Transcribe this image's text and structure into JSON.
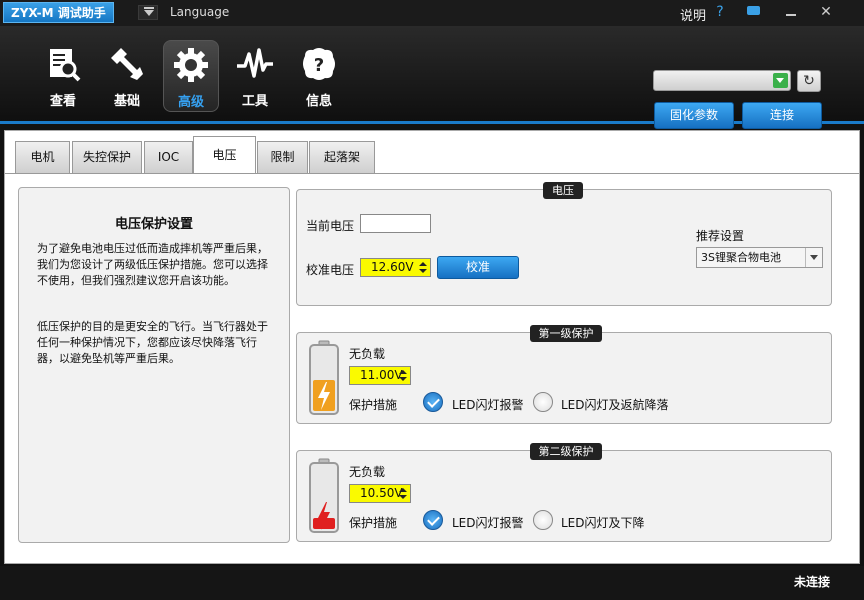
{
  "titlebar": {
    "app_title": "ZYX-M 调试助手",
    "language": "Language",
    "help": "说明",
    "help_icon": "?"
  },
  "toolbar": {
    "nav": [
      {
        "label": "查看",
        "icon": "view-icon"
      },
      {
        "label": "基础",
        "icon": "wrench-icon"
      },
      {
        "label": "高级",
        "icon": "gear-icon"
      },
      {
        "label": "工具",
        "icon": "pulse-icon"
      },
      {
        "label": "信息",
        "icon": "info-icon"
      }
    ],
    "active_nav": "高级",
    "firmware_button": "固化参数",
    "connect_button": "连接",
    "port_value": ""
  },
  "tabs": [
    "电机",
    "失控保护",
    "IOC",
    "电压",
    "限制",
    "起落架"
  ],
  "active_tab": "电压",
  "info": {
    "title": "电压保护设置",
    "para1": "为了避免电池电压过低而造成摔机等严重后果，我们为您设计了两级低压保护措施。您可以选择不使用，但我们强烈建议您开启该功能。",
    "para2": "低压保护的目的是更安全的飞行。当飞行器处于任何一种保护情况下，您都应该尽快降落飞行器，以避免坠机等严重后果。"
  },
  "voltage": {
    "group_title": "电压",
    "current_label": "当前电压",
    "current_value": "",
    "calibrate_label": "校准电压",
    "calibrate_value": "12.60V",
    "calibrate_button": "校准",
    "recommend_label": "推荐设置",
    "recommend_value": "3S锂聚合物电池"
  },
  "level1": {
    "title": "第一级保护",
    "noload_label": "无负载",
    "value": "11.00V",
    "measure_label": "保护措施",
    "option_a": "LED闪灯报警",
    "option_b": "LED闪灯及返航降落",
    "selected": "LED闪灯报警"
  },
  "level2": {
    "title": "第二级保护",
    "noload_label": "无负载",
    "value": "10.50V",
    "measure_label": "保护措施",
    "option_a": "LED闪灯报警",
    "option_b": "LED闪灯及下降",
    "selected": "LED闪灯报警"
  },
  "status": {
    "connection": "未连接"
  },
  "colors": {
    "accent": "#1a7ac8",
    "spin_bg": "#fafa00",
    "battery_level1": "#f0a020",
    "battery_level2": "#e02020"
  }
}
